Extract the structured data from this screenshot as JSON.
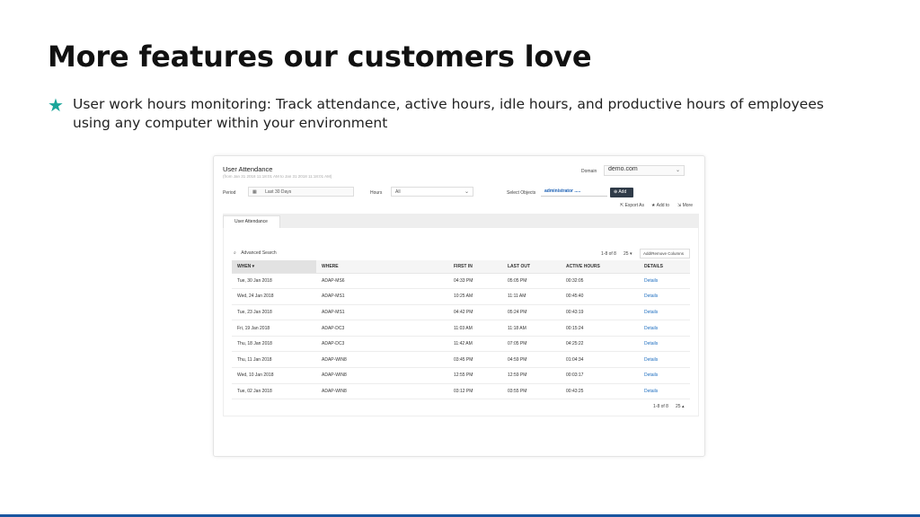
{
  "slide": {
    "title": "More features our customers love",
    "bullet_icon": "star-icon",
    "accent_color": "#19a69a",
    "bullet_text": "User work hours monitoring: Track attendance, active hours, idle hours, and productive hours of employees using any computer within your environment"
  },
  "report": {
    "title": "User Attendance",
    "range": "(from Jan 31 2018 11:18:01 AM to Jan 31 2018 11:18:01 AM)",
    "domain_label": "Domain",
    "domain_value": "demo.com",
    "period_label": "Period",
    "period_value": "Last 30 Days",
    "hours_label": "Hours",
    "hours_value": "All",
    "select_objects_label": "Select Objects",
    "select_objects_value": "administrator .....",
    "add_button": "Add",
    "export_label": "Export As",
    "addto_label": "Add to",
    "more_label": "More",
    "tab_label": "User Attendance",
    "advanced_search": "Advanced Search",
    "pager": "1-8 of 8",
    "page_size": "25",
    "columns_button": "Add/Remove Columns",
    "columns": [
      "WHEN",
      "WHERE",
      "FIRST IN",
      "LAST OUT",
      "ACTIVE HOURS",
      "DETAILS"
    ],
    "rows": [
      [
        "Tue, 30 Jan 2018",
        "ADAP-MS6",
        "04:33 PM",
        "05:05 PM",
        "00:32:05",
        "Details"
      ],
      [
        "Wed, 24 Jan 2018",
        "ADAP-MS1",
        "10:25 AM",
        "11:11 AM",
        "00:45:40",
        "Details"
      ],
      [
        "Tue, 23 Jan 2018",
        "ADAP-MS1",
        "04:42 PM",
        "05:24 PM",
        "00:43:19",
        "Details"
      ],
      [
        "Fri, 19 Jan 2018",
        "ADAP-DC3",
        "11:03 AM",
        "11:18 AM",
        "00:15:24",
        "Details"
      ],
      [
        "Thu, 18 Jan 2018",
        "ADAP-DC3",
        "11:42 AM",
        "07:05 PM",
        "04:25:22",
        "Details"
      ],
      [
        "Thu, 11 Jan 2018",
        "ADAP-WIN8",
        "03:45 PM",
        "04:59 PM",
        "01:04:34",
        "Details"
      ],
      [
        "Wed, 10 Jan 2018",
        "ADAP-WIN8",
        "12:55 PM",
        "12:59 PM",
        "00:03:17",
        "Details"
      ],
      [
        "Tue, 02 Jan 2018",
        "ADAP-WIN8",
        "03:12 PM",
        "03:55 PM",
        "00:43:25",
        "Details"
      ]
    ]
  }
}
